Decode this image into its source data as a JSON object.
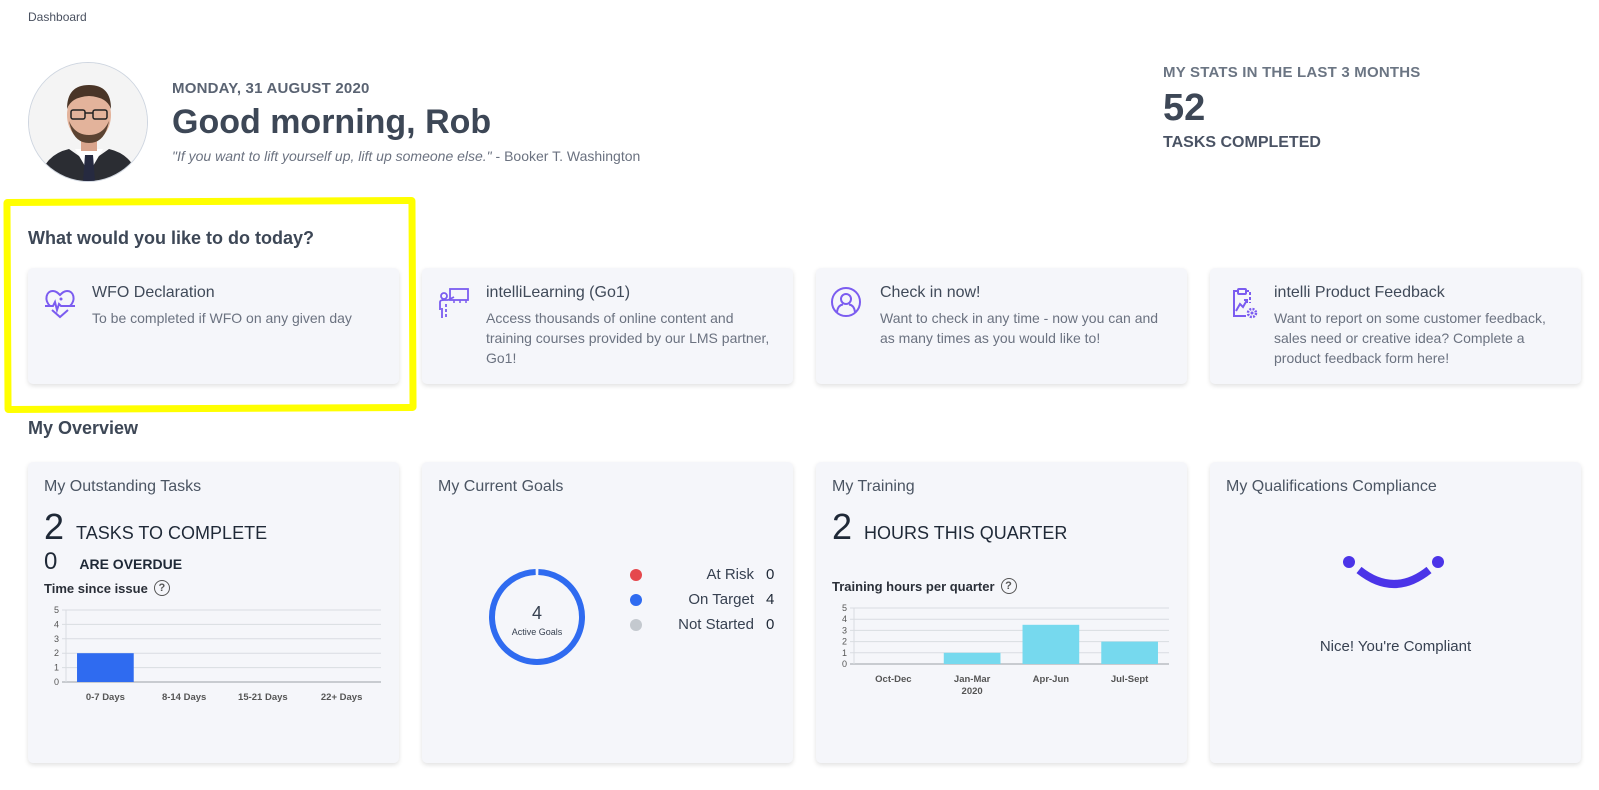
{
  "breadcrumb": "Dashboard",
  "header": {
    "date": "MONDAY, 31 AUGUST 2020",
    "greeting": "Good morning, Rob",
    "quote": "\"If you want to lift yourself up, lift up someone else.\"",
    "quote_author": " - Booker T. Washington"
  },
  "stats": {
    "label": "MY STATS IN THE LAST 3 MONTHS",
    "value": "52",
    "sublabel": "TASKS COMPLETED"
  },
  "actions": {
    "title": "What would you like to do today?",
    "items": [
      {
        "title": "WFO Declaration",
        "desc": "To be completed if WFO on any given day",
        "icon": "heart-pulse-icon"
      },
      {
        "title": "intelliLearning (Go1)",
        "desc": "Access thousands of online content and training courses provided by our LMS partner, Go1!",
        "icon": "teacher-board-icon"
      },
      {
        "title": "Check in now!",
        "desc": "Want to check in any time - now you can and as many times as you would like to!",
        "icon": "user-circle-icon"
      },
      {
        "title": "intelli Product Feedback",
        "desc": "Want to report on some customer feedback, sales need or creative idea? Complete a product feedback form here!",
        "icon": "clipboard-gear-icon"
      }
    ]
  },
  "overview": {
    "title": "My Overview",
    "tasks": {
      "title": "My Outstanding Tasks",
      "count": "2",
      "count_label": "TASKS TO COMPLETE",
      "overdue": "0",
      "overdue_label": "ARE OVERDUE",
      "chart_title": "Time since issue"
    },
    "goals": {
      "title": "My Current Goals",
      "center_value": "4",
      "center_label": "Active Goals",
      "legend": [
        {
          "label": "At Risk",
          "value": "0",
          "color": "#e5484d"
        },
        {
          "label": "On Target",
          "value": "4",
          "color": "#2f6bf0"
        },
        {
          "label": "Not Started",
          "value": "0",
          "color": "#c4c9cf"
        }
      ]
    },
    "training": {
      "title": "My Training",
      "count": "2",
      "count_label": "HOURS THIS QUARTER",
      "chart_title": "Training hours per quarter"
    },
    "compliance": {
      "title": "My Qualifications Compliance",
      "message": "Nice! You're Compliant",
      "color": "#4b34e8"
    }
  },
  "colors": {
    "accent": "#7b5cf0",
    "task_bar": "#2f6bf0",
    "training_bar": "#76d9ee",
    "highlight": "#ffff00"
  },
  "chart_data": [
    {
      "type": "bar",
      "title": "Time since issue",
      "categories": [
        "0-7 Days",
        "8-14 Days",
        "15-21 Days",
        "22+ Days"
      ],
      "values": [
        2,
        0,
        0,
        0
      ],
      "ylim": [
        0,
        5
      ],
      "yticks": [
        "0",
        "1",
        "2",
        "3",
        "4",
        "5"
      ],
      "grid": true
    },
    {
      "type": "pie",
      "title": "My Current Goals",
      "categories": [
        "At Risk",
        "On Target",
        "Not Started"
      ],
      "values": [
        0,
        4,
        0
      ]
    },
    {
      "type": "bar",
      "title": "Training hours per quarter",
      "categories": [
        "Oct-Dec",
        "Jan-Mar",
        "Apr-Jun",
        "Jul-Sept"
      ],
      "sublabels": [
        "",
        "2020",
        "",
        ""
      ],
      "values": [
        0,
        1,
        3.5,
        2
      ],
      "ylim": [
        0,
        5
      ],
      "yticks": [
        "0",
        "1",
        "2",
        "3",
        "4",
        "5"
      ],
      "grid": true
    }
  ]
}
